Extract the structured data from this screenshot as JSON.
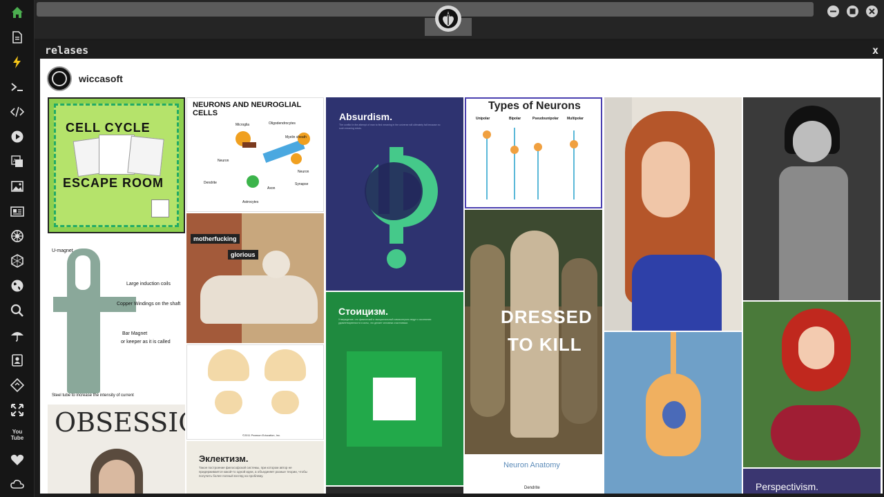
{
  "app": {
    "panel_title": "relases",
    "close_label": "x",
    "username": "wiccasoft"
  },
  "sidebar": {
    "icons": [
      "home-icon",
      "file-icon",
      "bolt-icon",
      "terminal-icon",
      "code-icon",
      "play-icon",
      "translate-icon",
      "image-icon",
      "news-icon",
      "settings-wheel-icon",
      "hexagon-icon",
      "globe-icon",
      "search-icon",
      "umbrella-icon",
      "contacts-icon",
      "git-icon",
      "expand-icon",
      "youtube-icon",
      "heart-icon",
      "cloud-icon"
    ],
    "youtube_label": "You Tube"
  },
  "tiles": {
    "cell_cycle": {
      "line1": "CELL CYCLE",
      "line2": "ESCAPE ROOM"
    },
    "ankh": {
      "label1": "U-magnet",
      "label2": "Large induction coils",
      "label3": "Copper Windings  on the shaft",
      "label4": "Bar Magnet",
      "label5": "or keeper as it is called",
      "label6": "Steel tube to increase the intensity of current"
    },
    "obsession": {
      "title": "OBSESSION"
    },
    "neuroglia": {
      "title": "NEURONS AND NEUROGLIAL CELLS",
      "microglia": "Microglia",
      "oligo": "Oligodendrocytes",
      "myelin": "Myelin sheath",
      "neuron": "Neuron",
      "neuron2": "Neuron",
      "dendrite": "Dendrite",
      "axon": "Axon",
      "synapse": "Synapse",
      "astro": "Astrocytes"
    },
    "statue": {
      "tag1": "motherfucking",
      "tag2": "glorious"
    },
    "brain": {
      "credit": "©2011 Pearson Education, Inc."
    },
    "eklektizm": {
      "title": "Эклектизм.",
      "text": "Такое построение философской системы, при котором автор не придерживается какой-то одной идеи, а объединяет разные теории, чтобы получить более полный взгляд на проблему."
    },
    "absurdism": {
      "title": "Absurdism.",
      "text": "The conflict in the attempt of man to find meaning in the universe will ultimately fail because no such meaning exists."
    },
    "stoicism": {
      "title": "Стоицизм.",
      "text": "Утверждение, что физический и эмоциональный самоконтроль ведут к осознанию удовлетворенности и силы, что делает человека счастливым."
    },
    "types": {
      "title": "Types of Neurons",
      "c1": "Unipolar",
      "c2": "Bipolar",
      "c3": "Pseudounipolar",
      "c4": "Multipolar"
    },
    "dressed": {
      "line1": "DRESSED",
      "line2": "TO KILL"
    },
    "anatomy": {
      "title": "Neuron Anatomy",
      "label": "Dendrite"
    },
    "perspectivism": {
      "title": "Perspectivism."
    }
  },
  "colors": {
    "accent_green": "#4caf50",
    "absurdism_bg": "#2e3370",
    "stoicism_bg": "#1f8a3f",
    "perspectivism_bg": "#3a3670"
  }
}
